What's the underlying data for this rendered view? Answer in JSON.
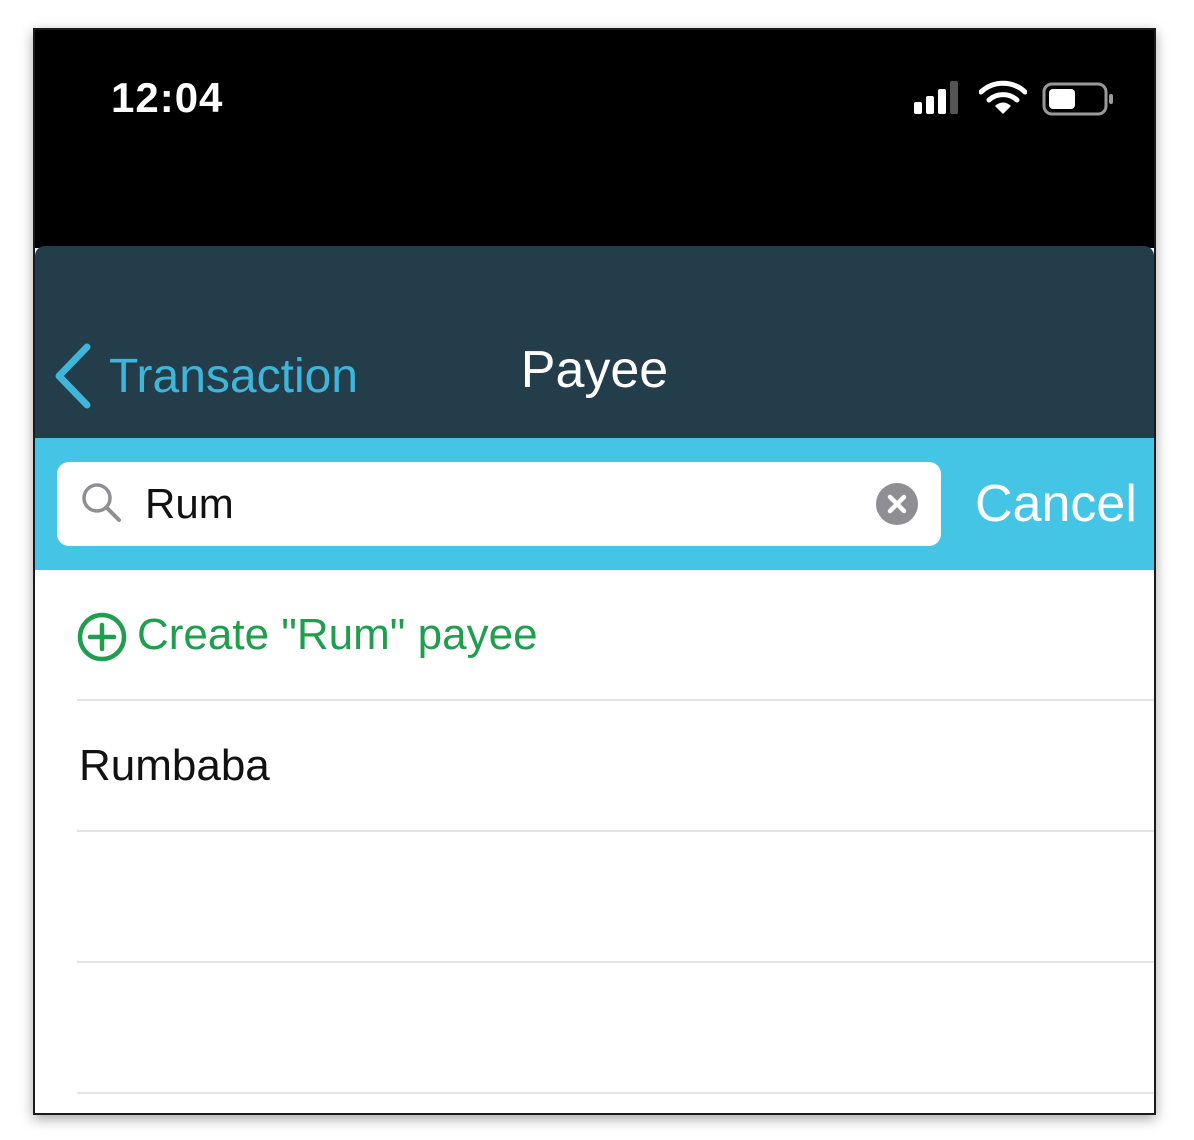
{
  "status_bar": {
    "time": "12:04",
    "icons": [
      "signal-icon",
      "wifi-icon",
      "battery-icon"
    ]
  },
  "nav": {
    "back_label": "Transaction",
    "title": "Payee",
    "background": "#233d4b",
    "accent": "#3fb6d9"
  },
  "search": {
    "value": "Rum",
    "cancel_label": "Cancel",
    "background": "#45c5e5"
  },
  "results": {
    "create_label": "Create \"Rum\" payee",
    "create_color": "#1f9e4d",
    "payees": [
      "Rumbaba"
    ]
  }
}
